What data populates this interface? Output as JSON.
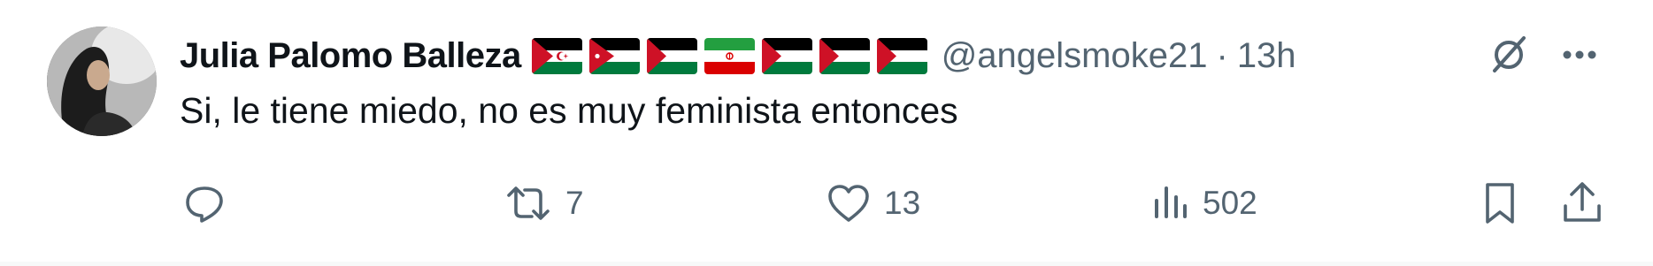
{
  "tweet": {
    "author_name": "Julia Palomo Balleza",
    "handle": "@angelsmoke21",
    "separator": "·",
    "time": "13h",
    "text": "Si, le tiene miedo, no es muy feminista entonces",
    "flags": [
      "western-sahara-flag",
      "jordan-flag",
      "palestine-flag",
      "iran-flag",
      "palestine-flag",
      "palestine-flag",
      "palestine-flag"
    ],
    "actions": {
      "reply_count": "",
      "retweet_count": "7",
      "like_count": "13",
      "views_count": "502"
    }
  },
  "colors": {
    "text_primary": "#0f1419",
    "text_secondary": "#536471",
    "flag_green": "#007a3d",
    "flag_red": "#ce1126",
    "flag_black": "#000000"
  },
  "icons": {
    "reply": "reply-icon",
    "retweet": "retweet-icon",
    "like": "heart-icon",
    "views": "views-icon",
    "bookmark": "bookmark-icon",
    "share": "share-icon",
    "grok": "grok-icon",
    "more": "more-icon"
  }
}
